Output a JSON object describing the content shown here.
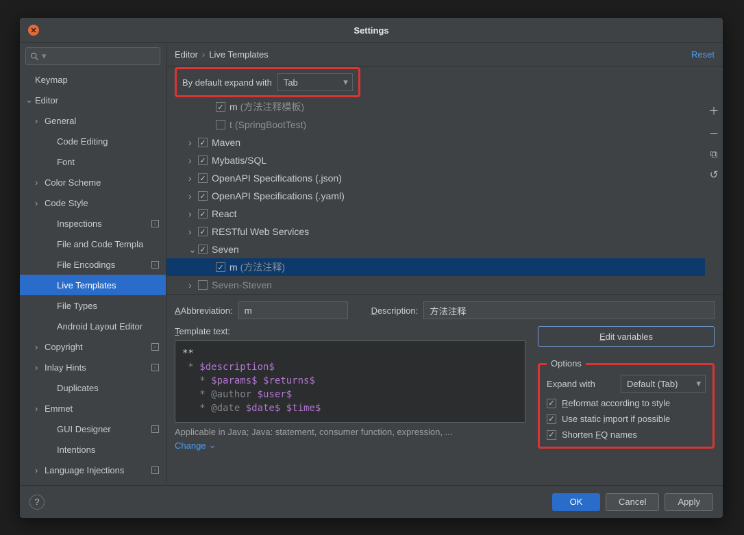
{
  "dialog_title": "Settings",
  "breadcrumb": {
    "a": "Editor",
    "b": "Live Templates"
  },
  "reset": "Reset",
  "expand_label": "By default expand with",
  "expand_value": "Tab",
  "sidebar": [
    {
      "label": "Keymap",
      "depth": 0
    },
    {
      "label": "Editor",
      "depth": 0,
      "chev": "down"
    },
    {
      "label": "General",
      "depth": 1,
      "chev": "right"
    },
    {
      "label": "Code Editing",
      "depth": 2
    },
    {
      "label": "Font",
      "depth": 2
    },
    {
      "label": "Color Scheme",
      "depth": 1,
      "chev": "right"
    },
    {
      "label": "Code Style",
      "depth": 1,
      "chev": "right"
    },
    {
      "label": "Inspections",
      "depth": 2,
      "badge": true
    },
    {
      "label": "File and Code Templa",
      "depth": 2
    },
    {
      "label": "File Encodings",
      "depth": 2,
      "badge": true
    },
    {
      "label": "Live Templates",
      "depth": 2,
      "sel": true
    },
    {
      "label": "File Types",
      "depth": 2
    },
    {
      "label": "Android Layout Editor",
      "depth": 2
    },
    {
      "label": "Copyright",
      "depth": 1,
      "chev": "right",
      "badge": true
    },
    {
      "label": "Inlay Hints",
      "depth": 1,
      "chev": "right",
      "badge": true
    },
    {
      "label": "Duplicates",
      "depth": 2
    },
    {
      "label": "Emmet",
      "depth": 1,
      "chev": "right"
    },
    {
      "label": "GUI Designer",
      "depth": 2,
      "badge": true
    },
    {
      "label": "Intentions",
      "depth": 2
    },
    {
      "label": "Language Injections",
      "depth": 1,
      "chev": "right",
      "badge": true
    }
  ],
  "tree": [
    {
      "kind": "leaf",
      "label": "m",
      "muted": "(方法注释模板)",
      "checked": true
    },
    {
      "kind": "leaf",
      "label": "t",
      "muted": "(SpringBootTest)",
      "checked": false,
      "mutedAll": true
    },
    {
      "kind": "group",
      "label": "Maven",
      "checked": true,
      "state": "collapsed"
    },
    {
      "kind": "group",
      "label": "Mybatis/SQL",
      "checked": true,
      "state": "collapsed"
    },
    {
      "kind": "group",
      "label": "OpenAPI Specifications (.json)",
      "checked": true,
      "state": "collapsed"
    },
    {
      "kind": "group",
      "label": "OpenAPI Specifications (.yaml)",
      "checked": true,
      "state": "collapsed"
    },
    {
      "kind": "group",
      "label": "React",
      "checked": true,
      "state": "collapsed"
    },
    {
      "kind": "group",
      "label": "RESTful Web Services",
      "checked": true,
      "state": "collapsed"
    },
    {
      "kind": "group",
      "label": "Seven",
      "checked": true,
      "state": "expanded"
    },
    {
      "kind": "leaf",
      "label": "m",
      "muted": "(方法注释)",
      "checked": true,
      "sel": true
    },
    {
      "kind": "group",
      "label": "Seven-Steven",
      "checked": false,
      "state": "collapsed",
      "mutedAll": true
    }
  ],
  "form": {
    "abbrev_label": "Abbreviation:",
    "abbrev_value": "m",
    "desc_label": "Description:",
    "desc_value": "方法注释",
    "tmpl_label": "Template text:",
    "editvars": "Edit variables"
  },
  "template_lines": [
    [
      {
        "t": "**",
        "c": "plain"
      }
    ],
    [
      {
        "t": " * ",
        "c": "doc"
      },
      {
        "t": "$description$",
        "c": "var"
      }
    ],
    [
      {
        "t": "   * ",
        "c": "doc"
      },
      {
        "t": "$params$ $returns$",
        "c": "var"
      }
    ],
    [
      {
        "t": "   * @author ",
        "c": "doc"
      },
      {
        "t": "$user$",
        "c": "var"
      }
    ],
    [
      {
        "t": "   * @date ",
        "c": "doc"
      },
      {
        "t": "$date$ $time$",
        "c": "var"
      }
    ]
  ],
  "applicable": "Applicable in Java; Java: statement, consumer function, expression, ...",
  "change": "Change",
  "options": {
    "title": "Options",
    "expand_label": "Expand with",
    "expand_value": "Default (Tab)",
    "reformat": "Reformat according to style",
    "static": "Use static import if possible",
    "shorten": "Shorten FQ names"
  },
  "footer": {
    "ok": "OK",
    "cancel": "Cancel",
    "apply": "Apply"
  }
}
